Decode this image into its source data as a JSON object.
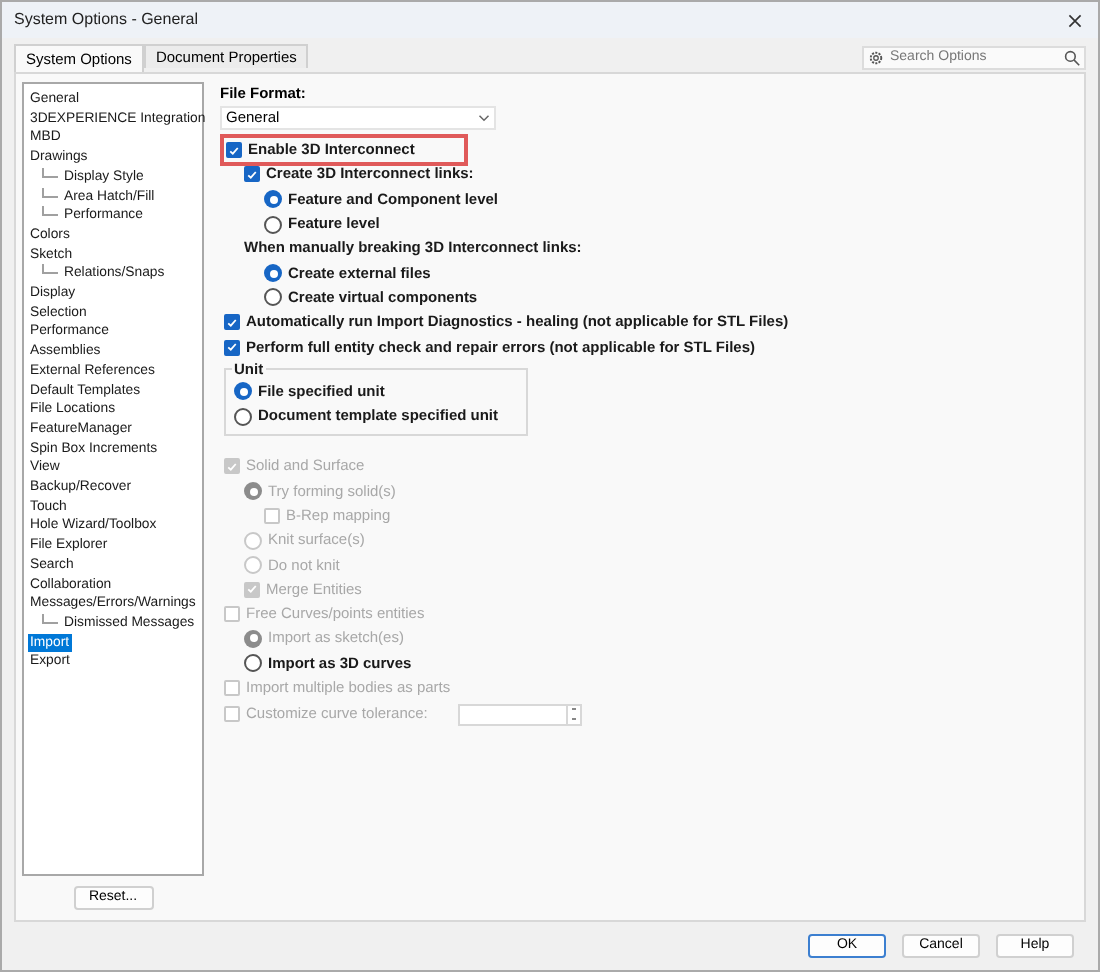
{
  "window": {
    "title": "System Options - General"
  },
  "tabs": [
    {
      "label": "System Options",
      "selected": true
    },
    {
      "label": "Document Properties",
      "selected": false
    }
  ],
  "search": {
    "placeholder": "Search Options"
  },
  "tree": [
    {
      "label": "General",
      "selected": false
    },
    {
      "label": "3DEXPERIENCE Integration",
      "selected": false
    },
    {
      "label": "MBD",
      "selected": false
    },
    {
      "label": "Drawings",
      "selected": false,
      "children": [
        {
          "label": "Display Style",
          "selected": false
        },
        {
          "label": "Area Hatch/Fill",
          "selected": false
        },
        {
          "label": "Performance",
          "selected": false
        }
      ]
    },
    {
      "label": "Colors",
      "selected": false
    },
    {
      "label": "Sketch",
      "selected": false,
      "children": [
        {
          "label": "Relations/Snaps",
          "selected": false
        }
      ]
    },
    {
      "label": "Display",
      "selected": false
    },
    {
      "label": "Selection",
      "selected": false
    },
    {
      "label": "Performance",
      "selected": false
    },
    {
      "label": "Assemblies",
      "selected": false
    },
    {
      "label": "External References",
      "selected": false
    },
    {
      "label": "Default Templates",
      "selected": false
    },
    {
      "label": "File Locations",
      "selected": false
    },
    {
      "label": "FeatureManager",
      "selected": false
    },
    {
      "label": "Spin Box Increments",
      "selected": false
    },
    {
      "label": "View",
      "selected": false
    },
    {
      "label": "Backup/Recover",
      "selected": false
    },
    {
      "label": "Touch",
      "selected": false
    },
    {
      "label": "Hole Wizard/Toolbox",
      "selected": false
    },
    {
      "label": "File Explorer",
      "selected": false
    },
    {
      "label": "Search",
      "selected": false
    },
    {
      "label": "Collaboration",
      "selected": false
    },
    {
      "label": "Messages/Errors/Warnings",
      "selected": false,
      "children": [
        {
          "label": "Dismissed Messages",
          "selected": false
        }
      ]
    },
    {
      "label": "Import",
      "selected": true
    },
    {
      "label": "Export",
      "selected": false
    }
  ],
  "reset_button": "Reset...",
  "file_format": {
    "label": "File Format:",
    "value": "General"
  },
  "options": [
    {
      "kind": "checkbox",
      "label": "Enable 3D Interconnect",
      "checked": true,
      "disabled": false,
      "highlighted": true,
      "children": [
        {
          "kind": "checkbox",
          "label": "Create 3D Interconnect links:",
          "checked": true,
          "disabled": false,
          "children": [
            {
              "kind": "radio",
              "label": "Feature and Component level",
              "selected": true,
              "disabled": false
            },
            {
              "kind": "radio",
              "label": "Feature level",
              "selected": false,
              "disabled": false
            }
          ]
        },
        {
          "kind": "label",
          "label": "When manually breaking 3D Interconnect links:",
          "disabled": false,
          "children": [
            {
              "kind": "radio",
              "label": "Create external files",
              "selected": true,
              "disabled": false
            },
            {
              "kind": "radio",
              "label": "Create virtual components",
              "selected": false,
              "disabled": false
            }
          ]
        }
      ]
    },
    {
      "kind": "checkbox",
      "label": "Automatically run Import Diagnostics - healing (not applicable for STL Files)",
      "checked": true,
      "disabled": false
    },
    {
      "kind": "checkbox",
      "label": "Perform full entity check and repair errors (not applicable for STL Files)",
      "checked": true,
      "disabled": false
    },
    {
      "kind": "group",
      "label": "Unit",
      "disabled": false,
      "children": [
        {
          "kind": "radio",
          "label": "File specified unit",
          "selected": true,
          "disabled": false
        },
        {
          "kind": "radio",
          "label": "Document template specified unit",
          "selected": false,
          "disabled": false
        }
      ]
    },
    {
      "kind": "checkbox",
      "label": "Solid and Surface",
      "checked": true,
      "disabled": true,
      "children": [
        {
          "kind": "radio",
          "label": "Try forming solid(s)",
          "selected": true,
          "disabled": true,
          "children": [
            {
              "kind": "checkbox",
              "label": "B-Rep mapping",
              "checked": false,
              "disabled": true
            }
          ]
        },
        {
          "kind": "radio",
          "label": "Knit surface(s)",
          "selected": false,
          "disabled": true
        },
        {
          "kind": "radio",
          "label": "Do not knit",
          "selected": false,
          "disabled": true
        },
        {
          "kind": "checkbox",
          "label": "Merge Entities",
          "checked": true,
          "disabled": true
        }
      ]
    },
    {
      "kind": "checkbox",
      "label": "Free Curves/points entities",
      "checked": false,
      "disabled": true,
      "children": [
        {
          "kind": "radio",
          "label": "Import as sketch(es)",
          "selected": true,
          "disabled": true
        },
        {
          "kind": "radio",
          "label": "Import as 3D curves",
          "selected": false,
          "disabled": false
        }
      ]
    },
    {
      "kind": "checkbox",
      "label": "Import multiple bodies as parts",
      "checked": false,
      "disabled": true
    },
    {
      "kind": "spinfield",
      "label": "Customize curve tolerance:",
      "checked": false,
      "disabled": true
    }
  ],
  "buttons": [
    {
      "label": "OK",
      "default": true
    },
    {
      "label": "Cancel",
      "default": false
    },
    {
      "label": "Help",
      "default": false
    }
  ]
}
